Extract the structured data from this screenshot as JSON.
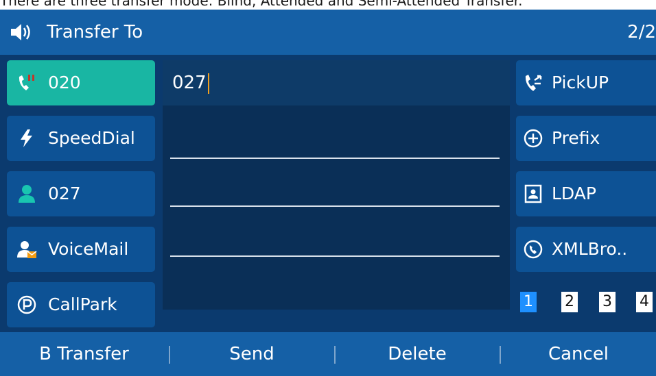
{
  "caption": "There are three transfer mode: Blind, Attended and Semi-Attended Transfer.",
  "titlebar": {
    "title": "Transfer To",
    "page": "2/2"
  },
  "left_buttons": [
    {
      "label": "020",
      "icon": "call-hold-icon",
      "active": true
    },
    {
      "label": "SpeedDial",
      "icon": "lightning-icon",
      "active": false
    },
    {
      "label": "027",
      "icon": "contact-icon",
      "active": false
    },
    {
      "label": "VoiceMail",
      "icon": "voicemail-contact-icon",
      "active": false
    },
    {
      "label": "CallPark",
      "icon": "park-icon",
      "active": false
    }
  ],
  "input": {
    "value": "027"
  },
  "right_buttons": [
    {
      "label": "PickUP",
      "icon": "pickup-icon"
    },
    {
      "label": "Prefix",
      "icon": "plus-circle-icon"
    },
    {
      "label": "LDAP",
      "icon": "directory-icon"
    },
    {
      "label": "XMLBro..",
      "icon": "globe-phone-icon"
    }
  ],
  "page_indicator": [
    "1",
    "2",
    "3",
    "4"
  ],
  "softkeys": [
    "B Transfer",
    "Send",
    "Delete",
    "Cancel"
  ],
  "colors": {
    "active_line": "#19b6a3",
    "title_bar": "#1560a6",
    "background": "#0b3a6e",
    "caret": "#f0a020"
  }
}
